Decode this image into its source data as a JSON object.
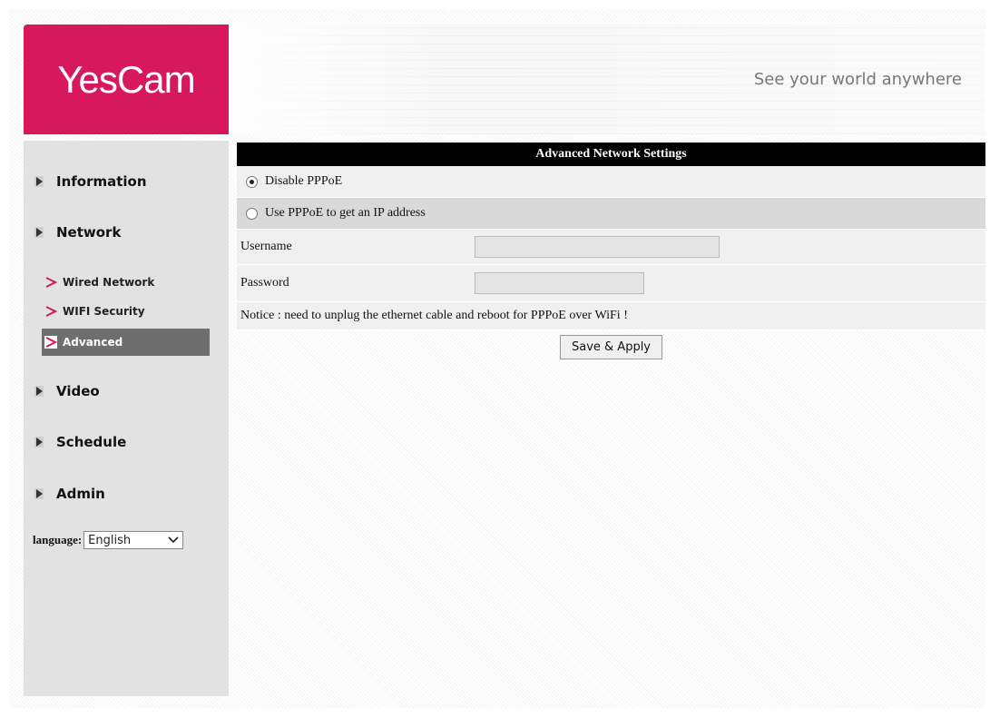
{
  "header": {
    "logo_text": "YesCam",
    "tagline": "See your world anywhere",
    "brand_color": "#d7185d"
  },
  "sidebar": {
    "main_items": [
      {
        "label": "Information",
        "icon": "triangle-right-icon"
      },
      {
        "label": "Network",
        "icon": "triangle-right-icon"
      },
      {
        "label": "Video",
        "icon": "triangle-right-icon"
      },
      {
        "label": "Schedule",
        "icon": "triangle-right-icon"
      },
      {
        "label": "Admin",
        "icon": "triangle-right-icon"
      }
    ],
    "network_sub_items": [
      {
        "label": "Wired Network",
        "active": false,
        "icon": "chevron-right-icon"
      },
      {
        "label": "WIFI Security",
        "active": false,
        "icon": "chevron-right-icon"
      },
      {
        "label": "Advanced",
        "active": true,
        "icon": "chevron-right-icon"
      }
    ],
    "language_label": "language:",
    "language_value": "English"
  },
  "main": {
    "title": "Advanced Network Settings",
    "options": [
      {
        "label": "Disable PPPoE",
        "selected": true
      },
      {
        "label": "Use PPPoE to get an IP address",
        "selected": false
      }
    ],
    "username_label": "Username",
    "password_label": "Password",
    "notice": "Notice : need to unplug the ethernet cable and reboot for PPPoE over WiFi !",
    "apply_label": "Save & Apply"
  }
}
